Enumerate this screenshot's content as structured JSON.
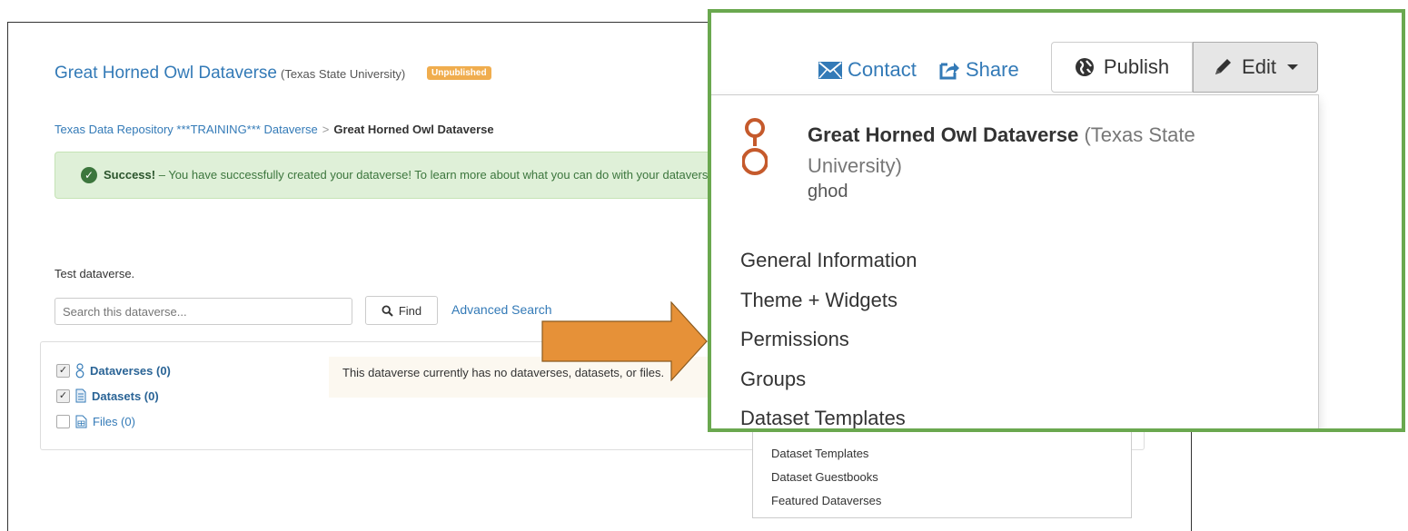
{
  "page": {
    "title": "Great Horned Owl Dataverse",
    "affiliation": "(Texas State University)",
    "badge": "Unpublished",
    "breadcrumb": {
      "parent": "Texas Data Repository ***TRAINING*** Dataverse",
      "separator": ">",
      "current": "Great Horned Owl Dataverse"
    },
    "alert": {
      "strong": "Success!",
      "text": " – You have successfully created your dataverse! To learn more about what you can do with your dataverse"
    },
    "description": "Test dataverse.",
    "search": {
      "placeholder": "Search this dataverse...",
      "find_label": "Find",
      "advanced_label": "Advanced Search"
    },
    "facets": [
      {
        "label": "Dataverses (0)",
        "checked": true,
        "icon": "dataverse-icon"
      },
      {
        "label": "Datasets (0)",
        "checked": true,
        "icon": "dataset-icon"
      },
      {
        "label": "Files (0)",
        "checked": false,
        "icon": "file-icon"
      }
    ],
    "empty_message": "This dataverse currently has no dataverses, datasets, or files.",
    "menu_items_small": [
      "Dataset Templates",
      "Dataset Guestbooks",
      "Featured Dataverses"
    ]
  },
  "zoom": {
    "contact_label": "Contact",
    "share_label": "Share",
    "publish_label": "Publish",
    "edit_label": "Edit",
    "dataverse_name": "Great Horned Owl Dataverse",
    "dataverse_affiliation": "(Texas State University)",
    "alias": "ghod",
    "menu_items": [
      "General Information",
      "Theme + Widgets",
      "Permissions",
      "Groups",
      "Dataset Templates"
    ]
  },
  "colors": {
    "link": "#337ab7",
    "badge": "#f0ad4e",
    "success_bg": "#dff0d8",
    "zoom_border": "#6aa84f",
    "arrow": "#e69138",
    "dataverse_logo": "#c55a2c"
  }
}
